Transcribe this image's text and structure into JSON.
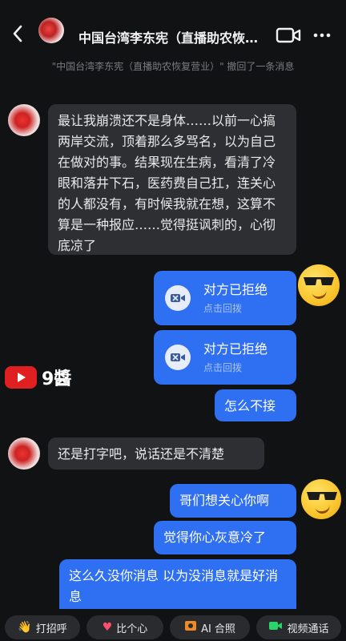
{
  "header": {
    "title": "中国台湾李东宪（直播助农恢…"
  },
  "notice": "\"中国台湾李东宪（直播助农恢复营业）\" 撤回了一条消息",
  "messages": {
    "m1": "最让我崩溃还不是身体……以前一心搞两岸交流，顶着那么多骂名，以为自己在做对的事。结果现在生病，看清了冷眼和落井下石，医药费自己扛，连关心的人都没有，有时候我就在想，这算不算是一种报应……觉得挺讽刺的，心彻底凉了",
    "call1": {
      "title": "对方已拒绝",
      "sub": "点击回拨"
    },
    "call2": {
      "title": "对方已拒绝",
      "sub": "点击回拨"
    },
    "m2": "怎么不接",
    "m3": "还是打字吧，说话还是不清楚",
    "m4": "哥们想关心你啊",
    "m5": "觉得你心灰意冷了",
    "m6": "这么久没你消息 以为没消息就是好消息"
  },
  "watermark": {
    "text": "9醬"
  },
  "bottom": {
    "chips": [
      {
        "label": "打招呼",
        "icon": "wave-emoji-icon"
      },
      {
        "label": "比个心",
        "icon": "heart-icon"
      },
      {
        "label": "AI 合照",
        "icon": "photo-icon"
      },
      {
        "label": "视频通话",
        "icon": "video-call-icon"
      }
    ]
  },
  "colors": {
    "background": "#111214",
    "incoming_bubble": "#2e2f33",
    "outgoing_bubble": "#2f6ff2"
  }
}
